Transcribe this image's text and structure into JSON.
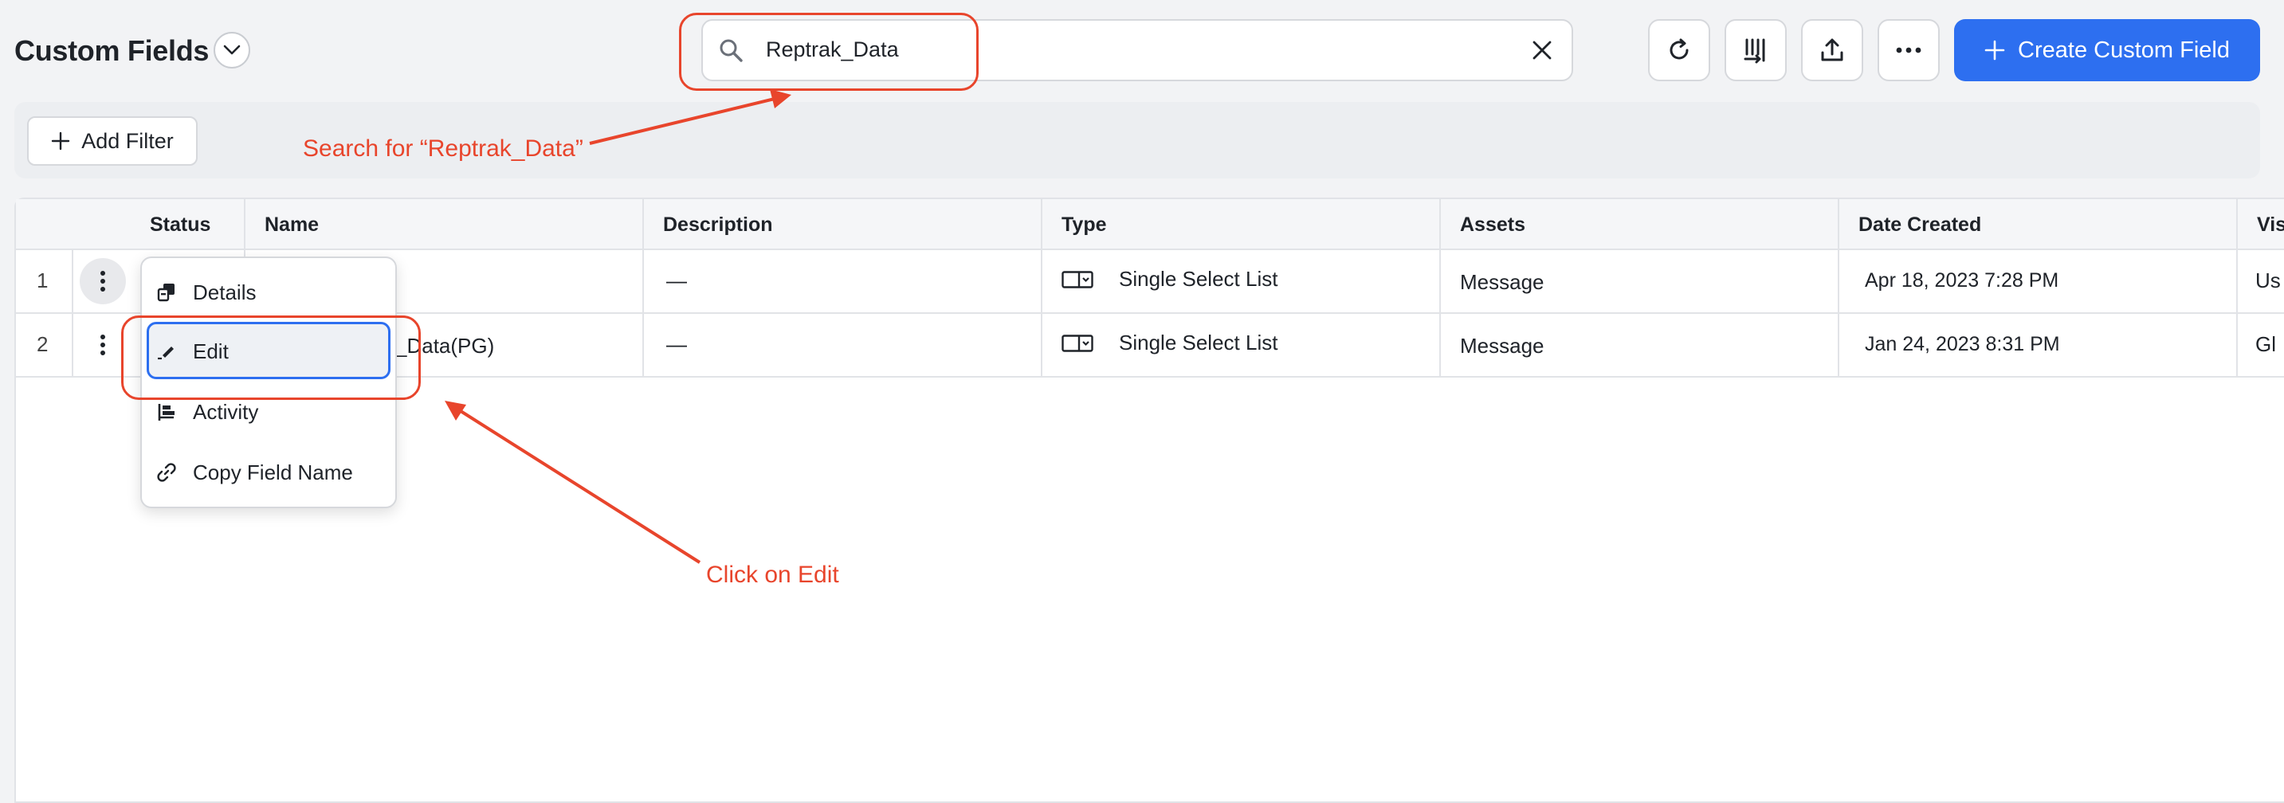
{
  "header": {
    "title": "Custom Fields",
    "search_value": "Reptrak_Data",
    "create_button": "Create Custom Field",
    "add_filter": "Add Filter"
  },
  "table": {
    "columns": [
      "Status",
      "Name",
      "Description",
      "Type",
      "Assets",
      "Date Created",
      "Vis"
    ],
    "rows": [
      {
        "num": "1",
        "name": "",
        "description": "—",
        "type": "Single Select List",
        "assets": "Message",
        "date": "Apr 18, 2023 7:28 PM",
        "vis": "Us"
      },
      {
        "num": "2",
        "name": "_Data(PG)",
        "description": "—",
        "type": "Single Select List",
        "assets": "Message",
        "date": "Jan 24, 2023 8:31 PM",
        "vis": "Gl"
      }
    ]
  },
  "menu": {
    "items": [
      "Details",
      "Edit",
      "Activity",
      "Copy Field Name"
    ]
  },
  "annotations": {
    "search_hint": "Search for “Reptrak_Data”",
    "click_hint": "Click on Edit",
    "color": "#e8452c"
  },
  "colors": {
    "accent": "#2d6ff0"
  }
}
